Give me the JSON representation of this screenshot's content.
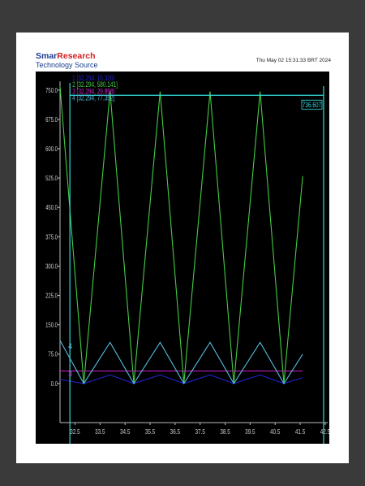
{
  "header": {
    "logo_part1": "Smar",
    "logo_part2": "Research",
    "logo_sub": "Technology Source",
    "timestamp": "Thu May 02 15:31:33 BRT 2024"
  },
  "colors": {
    "background": "#000000",
    "series1": "#2222cc",
    "series2": "#44cc44",
    "series3": "#cc22cc",
    "series4": "#55bbdd",
    "cursor": "#33dddd",
    "axis_text": "#cccccc"
  },
  "chart_data": {
    "type": "line",
    "xlim": [
      31.9,
      42.6
    ],
    "ylim": [
      -100,
      760
    ],
    "x_ticks": [
      "32.5",
      "33.5",
      "34.5",
      "35.5",
      "36.5",
      "37.5",
      "38.5",
      "39.5",
      "40.5",
      "41.5",
      "42.5"
    ],
    "y_ticks": [
      "750.0",
      "675.0",
      "600.0",
      "525.0",
      "450.0",
      "375.0",
      "300.0",
      "225.0",
      "150.0",
      "75.0",
      "0.0"
    ],
    "cursor": {
      "x": 32.294,
      "label": "736.607",
      "y": 736.607
    },
    "legend": [
      {
        "id": "1",
        "text": "[32.294, 15.326]",
        "color": "#2222cc"
      },
      {
        "id": "2",
        "text": "[32.294, 580.141]",
        "color": "#44cc44"
      },
      {
        "id": "3",
        "text": "[32.294, 29.898]",
        "color": "#cc22cc"
      },
      {
        "id": "4",
        "text": "[32.294, 77.352]",
        "color": "#55bbdd"
      }
    ],
    "series_labels": [
      {
        "text": "4",
        "x": 32.1,
        "y": 95,
        "color": "#55bbdd"
      },
      {
        "text": "3",
        "x": 32.1,
        "y": 25,
        "color": "#cc22cc"
      }
    ],
    "series": [
      {
        "id": "1",
        "color": "#2222cc",
        "points": [
          [
            31.9,
            10
          ],
          [
            32.85,
            0
          ],
          [
            33.9,
            22
          ],
          [
            34.85,
            0
          ],
          [
            35.9,
            22
          ],
          [
            36.85,
            0
          ],
          [
            37.9,
            22
          ],
          [
            38.85,
            0
          ],
          [
            39.9,
            22
          ],
          [
            40.85,
            0
          ],
          [
            41.6,
            15
          ]
        ]
      },
      {
        "id": "2",
        "color": "#44cc44",
        "points": [
          [
            31.9,
            760
          ],
          [
            32.85,
            0
          ],
          [
            33.9,
            746
          ],
          [
            34.85,
            0
          ],
          [
            35.9,
            746
          ],
          [
            36.85,
            0
          ],
          [
            37.9,
            746
          ],
          [
            38.85,
            0
          ],
          [
            39.9,
            746
          ],
          [
            40.85,
            0
          ],
          [
            41.6,
            530
          ]
        ]
      },
      {
        "id": "3",
        "color": "#cc22cc",
        "points": [
          [
            31.9,
            32
          ],
          [
            41.6,
            32
          ]
        ]
      },
      {
        "id": "4",
        "color": "#55bbdd",
        "points": [
          [
            31.9,
            110
          ],
          [
            32.85,
            0
          ],
          [
            33.9,
            105
          ],
          [
            34.85,
            0
          ],
          [
            35.9,
            105
          ],
          [
            36.85,
            0
          ],
          [
            37.9,
            105
          ],
          [
            38.85,
            0
          ],
          [
            39.9,
            105
          ],
          [
            40.85,
            0
          ],
          [
            41.6,
            75
          ]
        ]
      }
    ]
  }
}
